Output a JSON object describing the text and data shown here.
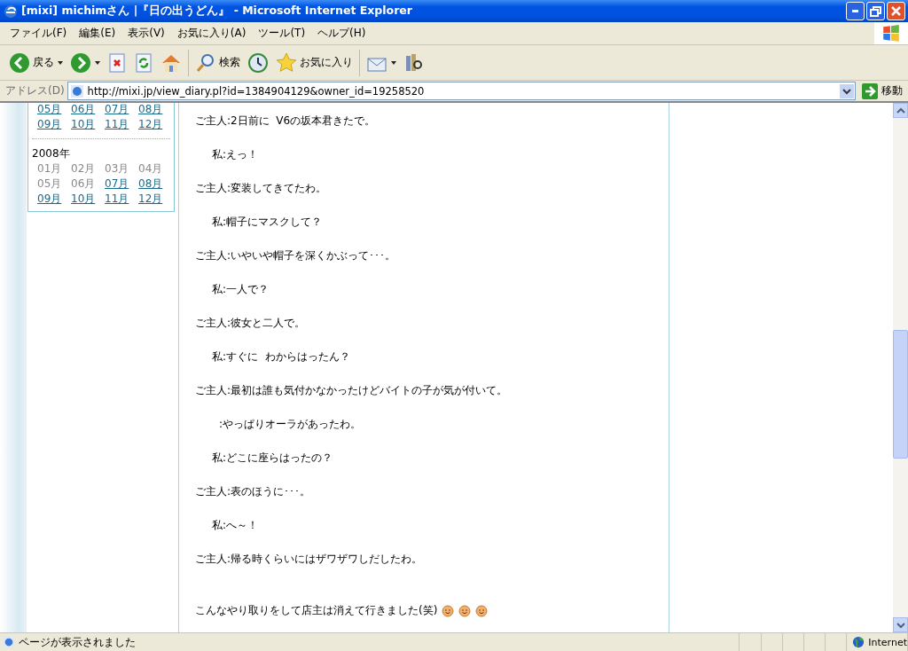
{
  "window": {
    "title": "[mixi] michimさん |『日の出うどん』 - Microsoft Internet Explorer"
  },
  "menu": [
    "ファイル(F)",
    "編集(E)",
    "表示(V)",
    "お気に入り(A)",
    "ツール(T)",
    "ヘルプ(H)"
  ],
  "toolbar": {
    "back": "戻る",
    "search": "検索",
    "favorites": "お気に入り"
  },
  "address": {
    "label": "アドレス(D)",
    "value": "http://mixi.jp/view_diary.pl?id=1384904129&owner_id=19258520",
    "go": "移動"
  },
  "calendar": [
    {
      "months": [
        {
          "label": "05月",
          "linked": true
        },
        {
          "label": "06月",
          "linked": true
        },
        {
          "label": "07月",
          "linked": true
        },
        {
          "label": "08月",
          "linked": true
        },
        {
          "label": "09月",
          "linked": true
        },
        {
          "label": "10月",
          "linked": true
        },
        {
          "label": "11月",
          "linked": true
        },
        {
          "label": "12月",
          "linked": true
        }
      ]
    },
    {
      "year": "2008年",
      "months": [
        {
          "label": "01月",
          "linked": false
        },
        {
          "label": "02月",
          "linked": false
        },
        {
          "label": "03月",
          "linked": false
        },
        {
          "label": "04月",
          "linked": false
        },
        {
          "label": "05月",
          "linked": false
        },
        {
          "label": "06月",
          "linked": false
        },
        {
          "label": "07月",
          "linked": true
        },
        {
          "label": "08月",
          "linked": true
        },
        {
          "label": "09月",
          "linked": true
        },
        {
          "label": "10月",
          "linked": true
        },
        {
          "label": "11月",
          "linked": true
        },
        {
          "label": "12月",
          "linked": true
        }
      ]
    }
  ],
  "diary": [
    {
      "kind": "host",
      "text": "ご主人:2日前に  V6の坂本君きたで。"
    },
    {
      "kind": "me",
      "text": "私:えっ！"
    },
    {
      "kind": "host",
      "text": "ご主人:変装してきてたわ。"
    },
    {
      "kind": "me",
      "text": "私:帽子にマスクして？"
    },
    {
      "kind": "host",
      "text": "ご主人:いやいや帽子を深くかぶって･･･。"
    },
    {
      "kind": "me",
      "text": "私:一人で？"
    },
    {
      "kind": "host",
      "text": "ご主人:彼女と二人で。"
    },
    {
      "kind": "me",
      "text": "私:すぐに  わからはったん？"
    },
    {
      "kind": "host",
      "text": "ご主人:最初は誰も気付かなかったけどバイトの子が気が付いて。"
    },
    {
      "kind": "cont",
      "text": ":やっぱりオーラがあったわ。"
    },
    {
      "kind": "me",
      "text": "私:どこに座らはったの？"
    },
    {
      "kind": "host",
      "text": "ご主人:表のほうに･･･。"
    },
    {
      "kind": "me",
      "text": "私:へ～！"
    },
    {
      "kind": "host",
      "text": "ご主人:帰る時くらいにはザワザワしだしたわ。"
    },
    {
      "kind": "closing",
      "text": "こんなやり取りをして店主は消えて行きました(笑)"
    }
  ],
  "status_bar": {
    "message": "ページが表示されました",
    "zone": "Internet"
  }
}
